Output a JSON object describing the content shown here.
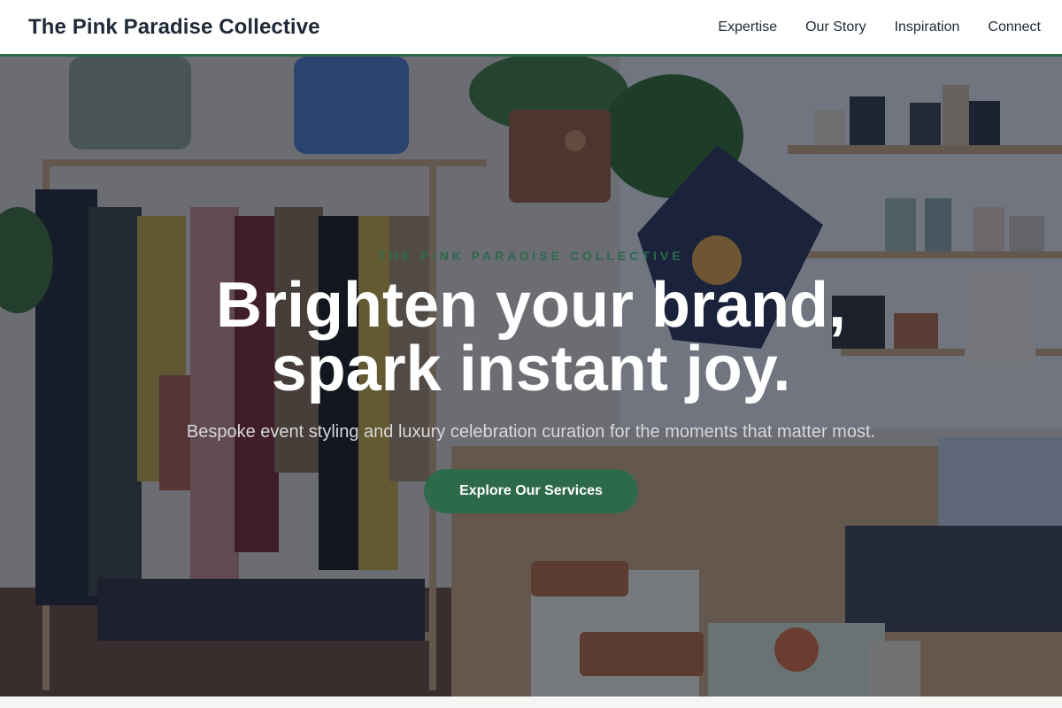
{
  "header": {
    "brand": "The Pink Paradise Collective",
    "nav": [
      "Expertise",
      "Our Story",
      "Inspiration",
      "Connect"
    ]
  },
  "hero": {
    "eyebrow": "The Pink Paradise Collective",
    "headline_line1": "Brighten your brand,",
    "headline_line2": "spark instant joy.",
    "subheadline": "Bespoke event styling and luxury celebration curation for the moments that matter most.",
    "cta_label": "Explore Our Services"
  },
  "colors": {
    "accent": "#2d6a4a",
    "text_dark": "#1f2937",
    "overlay": "rgba(17,24,39,0.55)"
  }
}
